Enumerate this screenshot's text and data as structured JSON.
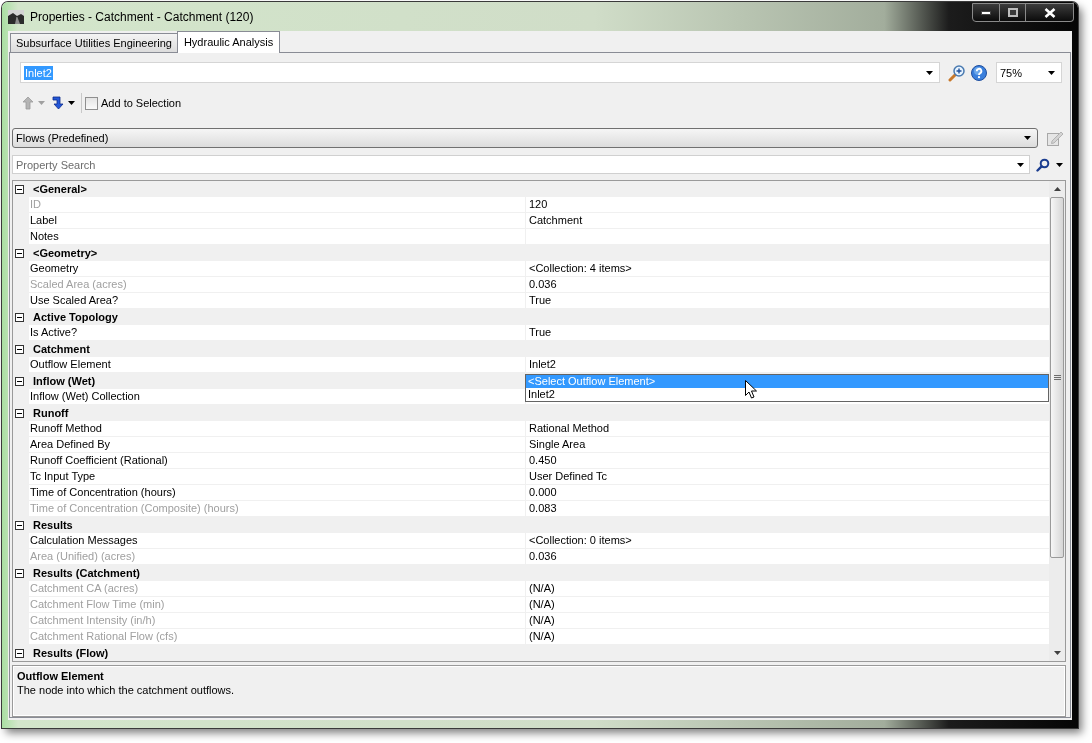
{
  "window": {
    "title": "Properties - Catchment - Catchment (120)"
  },
  "tabs": [
    {
      "label": "Subsurface Utilities Engineering",
      "selected": false
    },
    {
      "label": "Hydraulic Analysis",
      "selected": true
    }
  ],
  "element_combo": {
    "value": "Inlet2",
    "highlighted": true
  },
  "zoom_combo": {
    "value": "75%"
  },
  "toolbar": {
    "buttons": [
      {
        "kind": "navigate_up",
        "disabled": true
      },
      {
        "kind": "navigate_down",
        "disabled": false
      }
    ],
    "add_to_selection": {
      "label": "Add to Selection",
      "checked": false
    }
  },
  "view_combo": {
    "value": "Flows (Predefined)"
  },
  "edit_button": {
    "disabled": true
  },
  "property_search": {
    "placeholder": "Property Search"
  },
  "property_grid": {
    "categories": [
      {
        "label": "<General>",
        "expanded": true,
        "properties": [
          {
            "name": "ID",
            "read_only": true,
            "value": "120"
          },
          {
            "name": "Label",
            "read_only": false,
            "value": "Catchment"
          },
          {
            "name": "Notes",
            "read_only": false
          }
        ]
      },
      {
        "label": "<Geometry>",
        "expanded": true,
        "properties": [
          {
            "name": "Geometry",
            "read_only": false,
            "value": "<Collection: 4 items>"
          },
          {
            "name": "Scaled Area (acres)",
            "read_only": true,
            "value": "0.036"
          },
          {
            "name": "Use Scaled Area?",
            "read_only": false,
            "value": "True"
          }
        ]
      },
      {
        "label": "Active Topology",
        "expanded": true,
        "properties": [
          {
            "name": "Is Active?",
            "read_only": false,
            "value": "True"
          }
        ]
      },
      {
        "label": "Catchment",
        "expanded": true,
        "properties": [
          {
            "name": "Outflow Element",
            "read_only": false,
            "value": "Inlet2",
            "dropdown": {
              "items": [
                {
                  "label": "<Select Outflow Element>",
                  "selected": true
                },
                {
                  "label": "Inlet2",
                  "selected": false
                }
              ]
            }
          }
        ]
      },
      {
        "label": "Inflow (Wet)",
        "expanded": true,
        "properties": [
          {
            "name": "Inflow (Wet) Collection",
            "read_only": false
          }
        ]
      },
      {
        "label": "Runoff",
        "expanded": true,
        "properties": [
          {
            "name": "Runoff Method",
            "read_only": false,
            "value": "Rational Method"
          },
          {
            "name": "Area Defined By",
            "read_only": false,
            "value": "Single Area"
          },
          {
            "name": "Runoff Coefficient (Rational)",
            "read_only": false,
            "value": "0.450"
          },
          {
            "name": "Tc Input Type",
            "read_only": false,
            "value": "User Defined Tc"
          },
          {
            "name": "Time of Concentration (hours)",
            "read_only": false,
            "value": "0.000"
          },
          {
            "name": "Time of Concentration (Composite) (hours)",
            "read_only": true,
            "value": "0.083"
          }
        ]
      },
      {
        "label": "Results",
        "expanded": true,
        "properties": [
          {
            "name": "Calculation Messages",
            "read_only": false,
            "value": "<Collection: 0 items>"
          },
          {
            "name": "Area (Unified) (acres)",
            "read_only": true,
            "value": "0.036"
          }
        ]
      },
      {
        "label": "Results (Catchment)",
        "expanded": true,
        "properties": [
          {
            "name": "Catchment CA (acres)",
            "read_only": true,
            "value": "(N/A)"
          },
          {
            "name": "Catchment Flow Time (min)",
            "read_only": true,
            "value": "(N/A)"
          },
          {
            "name": "Catchment Intensity (in/h)",
            "read_only": true,
            "value": "(N/A)"
          },
          {
            "name": "Catchment Rational Flow (cfs)",
            "read_only": true,
            "value": "(N/A)"
          }
        ]
      },
      {
        "label": "Results (Flow)",
        "expanded": true
      }
    ]
  },
  "description": {
    "title": "Outflow Element",
    "text": "The node into which the catchment outflows."
  }
}
